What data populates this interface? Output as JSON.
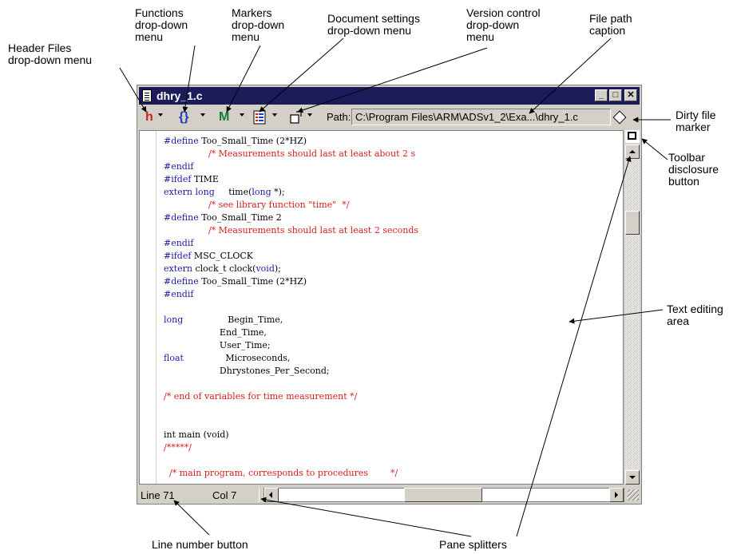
{
  "callouts": {
    "header_files": "Header Files\ndrop-down menu",
    "functions": "Functions\ndrop-down\nmenu",
    "markers": "Markers\ndrop-down\nmenu",
    "document_settings": "Document settings\ndrop-down menu",
    "version_control": "Version control\ndrop-down\nmenu",
    "file_path_caption": "File path\ncaption",
    "dirty_file_marker": "Dirty file\nmarker",
    "toolbar_disclosure": "Toolbar\ndisclosure\nbutton",
    "text_editing_area": "Text editing\narea",
    "line_number_button": "Line number button",
    "pane_splitters": "Pane splitters"
  },
  "window": {
    "title": "dhry_1.c",
    "path_label": "Path:",
    "path_value": "C:\\Program Files\\ARM\\ADSv1_2\\Exa...\\dhry_1.c"
  },
  "toolbar_icons": {
    "header": "h",
    "functions": "{}",
    "markers": "M"
  },
  "code_lines": [
    [
      {
        "t": "#define",
        "c": "kw"
      },
      {
        "t": " Too_Small_Time (2*HZ)"
      }
    ],
    [
      {
        "t": "                /* Measurements should last at least about 2 s",
        "c": "cm"
      }
    ],
    [
      {
        "t": "#endif",
        "c": "kw"
      }
    ],
    [
      {
        "t": "#ifdef",
        "c": "kw"
      },
      {
        "t": " TIME"
      }
    ],
    [
      {
        "t": "extern long",
        "c": "kw"
      },
      {
        "t": "     time("
      },
      {
        "t": "long",
        "c": "kw"
      },
      {
        "t": " *);"
      }
    ],
    [
      {
        "t": "                /* see library function \"time\"  */",
        "c": "cm"
      }
    ],
    [
      {
        "t": "#define",
        "c": "kw"
      },
      {
        "t": " Too_Small_Time 2"
      }
    ],
    [
      {
        "t": "                /* Measurements should last at least 2 seconds",
        "c": "cm"
      }
    ],
    [
      {
        "t": "#endif",
        "c": "kw"
      }
    ],
    [
      {
        "t": "#ifdef",
        "c": "kw"
      },
      {
        "t": " MSC_CLOCK"
      }
    ],
    [
      {
        "t": "extern",
        "c": "kw"
      },
      {
        "t": " clock_t clock("
      },
      {
        "t": "void",
        "c": "kw"
      },
      {
        "t": ");"
      }
    ],
    [
      {
        "t": "#define",
        "c": "kw"
      },
      {
        "t": " Too_Small_Time (2*HZ)"
      }
    ],
    [
      {
        "t": "#endif",
        "c": "kw"
      }
    ],
    [
      {
        "t": ""
      }
    ],
    [
      {
        "t": "long",
        "c": "kw"
      },
      {
        "t": "                Begin_Time,"
      }
    ],
    [
      {
        "t": "                    End_Time,"
      }
    ],
    [
      {
        "t": "                    User_Time;"
      }
    ],
    [
      {
        "t": "float",
        "c": "kw"
      },
      {
        "t": "               Microseconds,"
      }
    ],
    [
      {
        "t": "                    Dhrystones_Per_Second;"
      }
    ],
    [
      {
        "t": ""
      }
    ],
    [
      {
        "t": "/* end of variables for time measurement */",
        "c": "cm"
      }
    ],
    [
      {
        "t": ""
      }
    ],
    [
      {
        "t": ""
      }
    ],
    [
      {
        "t": "int main (void)"
      }
    ],
    [
      {
        "t": "/*****/",
        "c": "cm"
      }
    ],
    [
      {
        "t": ""
      }
    ],
    [
      {
        "t": "  /* main program, corresponds to procedures        */",
        "c": "cm"
      }
    ]
  ],
  "status": {
    "line": "Line 71",
    "col": "Col 7"
  },
  "colors": {
    "titlebar": "#1c1c5a",
    "keyword": "#1c1ca0",
    "comment": "#d02020",
    "header_icon": "#d02020",
    "functions_icon": "#1c3cc0",
    "markers_icon": "#1a7a3a"
  }
}
